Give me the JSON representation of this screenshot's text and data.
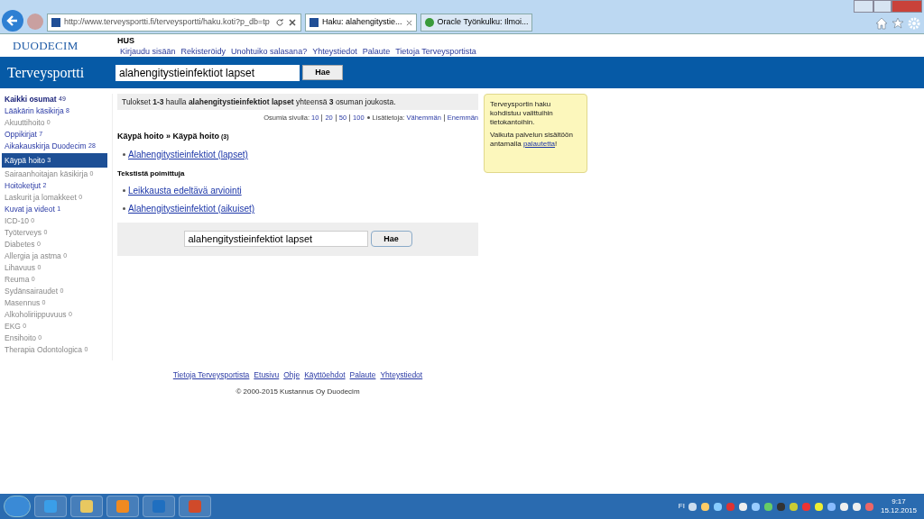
{
  "browser": {
    "url": "http://www.terveysportti.fi/terveysportti/haku.koti?p_db=tp",
    "tabs": [
      {
        "title": "Haku: alahengitystie...",
        "selected": true
      },
      {
        "title": "Oracle Työnkulku: Ilmoi...",
        "selected": false
      }
    ]
  },
  "header": {
    "logo": "DUODECIM",
    "org": "HUS",
    "links": [
      "Kirjaudu sisään",
      "Rekisteröidy",
      "Unohtuiko salasana?",
      "Yhteystiedot",
      "Palaute",
      "Tietoja Terveysportista"
    ],
    "brand": "Terveysportti",
    "search_value": "alahengitystieinfektiot lapset",
    "search_button": "Hae"
  },
  "sidebar": {
    "items": [
      {
        "label": "Kaikki osumat",
        "count": "49",
        "kind": "total",
        "disabled": false,
        "selected": false
      },
      {
        "label": "Lääkärin käsikirja",
        "count": "8",
        "kind": "category",
        "disabled": false,
        "selected": false
      },
      {
        "label": "Akuuttihoito",
        "count": "0",
        "kind": "category",
        "disabled": true,
        "selected": false
      },
      {
        "label": "Oppikirjat",
        "count": "7",
        "kind": "category",
        "disabled": false,
        "selected": false
      },
      {
        "label": "Aikakauskirja Duodecim",
        "count": "28",
        "kind": "category",
        "disabled": false,
        "selected": false
      },
      {
        "label": "Käypä hoito",
        "count": "3",
        "kind": "category",
        "disabled": false,
        "selected": true
      },
      {
        "label": "Sairaanhoitajan käsikirja",
        "count": "0",
        "kind": "category",
        "disabled": true,
        "selected": false
      },
      {
        "label": "Hoitoketjut",
        "count": "2",
        "kind": "category",
        "disabled": false,
        "selected": false
      },
      {
        "label": "Laskurit ja lomakkeet",
        "count": "0",
        "kind": "category",
        "disabled": true,
        "selected": false
      },
      {
        "label": "Kuvat ja videot",
        "count": "1",
        "kind": "category",
        "disabled": false,
        "selected": false
      },
      {
        "label": "ICD-10",
        "count": "0",
        "kind": "category",
        "disabled": true,
        "selected": false
      },
      {
        "label": "Työterveys",
        "count": "0",
        "kind": "category",
        "disabled": true,
        "selected": false
      },
      {
        "label": "Diabetes",
        "count": "0",
        "kind": "category",
        "disabled": true,
        "selected": false
      },
      {
        "label": "Allergia ja astma",
        "count": "0",
        "kind": "category",
        "disabled": true,
        "selected": false
      },
      {
        "label": "Lihavuus",
        "count": "0",
        "kind": "category",
        "disabled": true,
        "selected": false
      },
      {
        "label": "Reuma",
        "count": "0",
        "kind": "category",
        "disabled": true,
        "selected": false
      },
      {
        "label": "Sydänsairaudet",
        "count": "0",
        "kind": "category",
        "disabled": true,
        "selected": false
      },
      {
        "label": "Masennus",
        "count": "0",
        "kind": "category",
        "disabled": true,
        "selected": false
      },
      {
        "label": "Alkoholiriippuvuus",
        "count": "0",
        "kind": "category",
        "disabled": true,
        "selected": false
      },
      {
        "label": "EKG",
        "count": "0",
        "kind": "category",
        "disabled": true,
        "selected": false
      },
      {
        "label": "Ensihoito",
        "count": "0",
        "kind": "category",
        "disabled": true,
        "selected": false
      },
      {
        "label": "Therapia Odontologica",
        "count": "0",
        "kind": "category",
        "disabled": true,
        "selected": false
      }
    ]
  },
  "results": {
    "summary": "Tulokset **1-3** haulla **alahengitystieinfektiot lapset** yhteensä **3** osuman joukosta.",
    "per_page_label": "Osumia sivulla:",
    "per_page": [
      "10",
      "20",
      "50",
      "100"
    ],
    "details_label": "Lisätietoja:",
    "details": [
      "Vähemmän",
      "Enemmän"
    ],
    "groups": [
      {
        "title": "Käypä hoito » Käypä hoito",
        "count": "(3)",
        "kind": "main",
        "items": [
          "Alahengitystieinfektiot (lapset)"
        ]
      },
      {
        "title": "Tekstistä poimittuja",
        "kind": "sub",
        "items": [
          "Leikkausta edeltävä arviointi",
          "Alahengitystieinfektiot (aikuiset)"
        ]
      }
    ],
    "search_value": "alahengitystieinfektiot lapset",
    "search_button": "Hae"
  },
  "notice": {
    "lines": [
      "Terveysportin haku kohdistuu valittuihin tietokantoihin."
    ],
    "feedback_text": "Vaikuta palvelun sisältöön antamalla",
    "feedback_link": "palautetta",
    "feedback_end": "!"
  },
  "footer": {
    "links": [
      "Tietoja Terveysportista",
      "Etusivu",
      "Ohje",
      "Käyttöehdot",
      "Palaute",
      "Yhteystiedot"
    ],
    "copyright": "© 2000-2015 Kustannus Oy Duodecim"
  },
  "taskbar": {
    "language": "FI",
    "time": "9:17",
    "date": "15.12.2015"
  }
}
